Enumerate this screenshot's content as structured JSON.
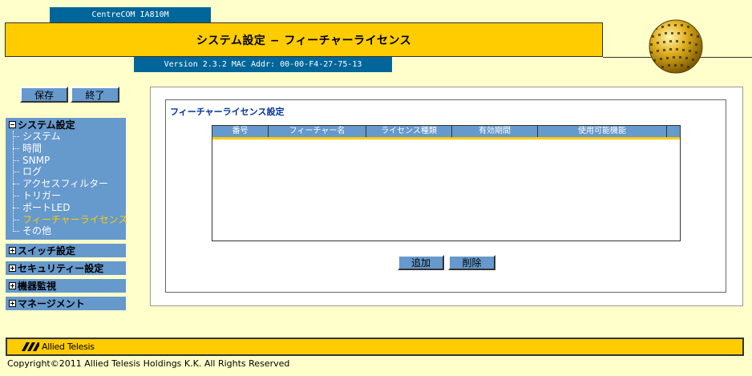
{
  "header": {
    "model": "CentreCOM IA810M",
    "title": "システム設定 − フィーチャーライセンス",
    "version_text": "Version 2.3.2 MAC Addr: 00-00-F4-27-75-13"
  },
  "toolbar": {
    "save_label": "保存",
    "exit_label": "終了"
  },
  "sidebar": {
    "system": {
      "label": "システム設定",
      "items": [
        {
          "label": "システム"
        },
        {
          "label": "時間"
        },
        {
          "label": "SNMP"
        },
        {
          "label": "ログ"
        },
        {
          "label": "アクセスフィルター"
        },
        {
          "label": "トリガー"
        },
        {
          "label": "ポートLED"
        },
        {
          "label": "フィーチャーライセンス"
        },
        {
          "label": "その他"
        }
      ]
    },
    "switch": {
      "label": "スイッチ設定"
    },
    "security": {
      "label": "セキュリティー設定"
    },
    "monitor": {
      "label": "機器監視"
    },
    "management": {
      "label": "マネージメント"
    }
  },
  "main": {
    "section_title": "フィーチャーライセンス設定",
    "table": {
      "columns": [
        "番号",
        "フィーチャー名",
        "ライセンス種類",
        "有効期間",
        "使用可能機能",
        ""
      ],
      "rows": []
    },
    "add_label": "追加",
    "delete_label": "削除"
  },
  "footer": {
    "logo_text": "Allied Telesis",
    "copyright": "Copyright©2011 Allied Telesis Holdings K.K. All Rights Reserved"
  },
  "colors": {
    "background": "#FFFFCC",
    "accent_yellow": "#FFCC00",
    "accent_blue": "#6699CC",
    "header_blue": "#006699"
  }
}
